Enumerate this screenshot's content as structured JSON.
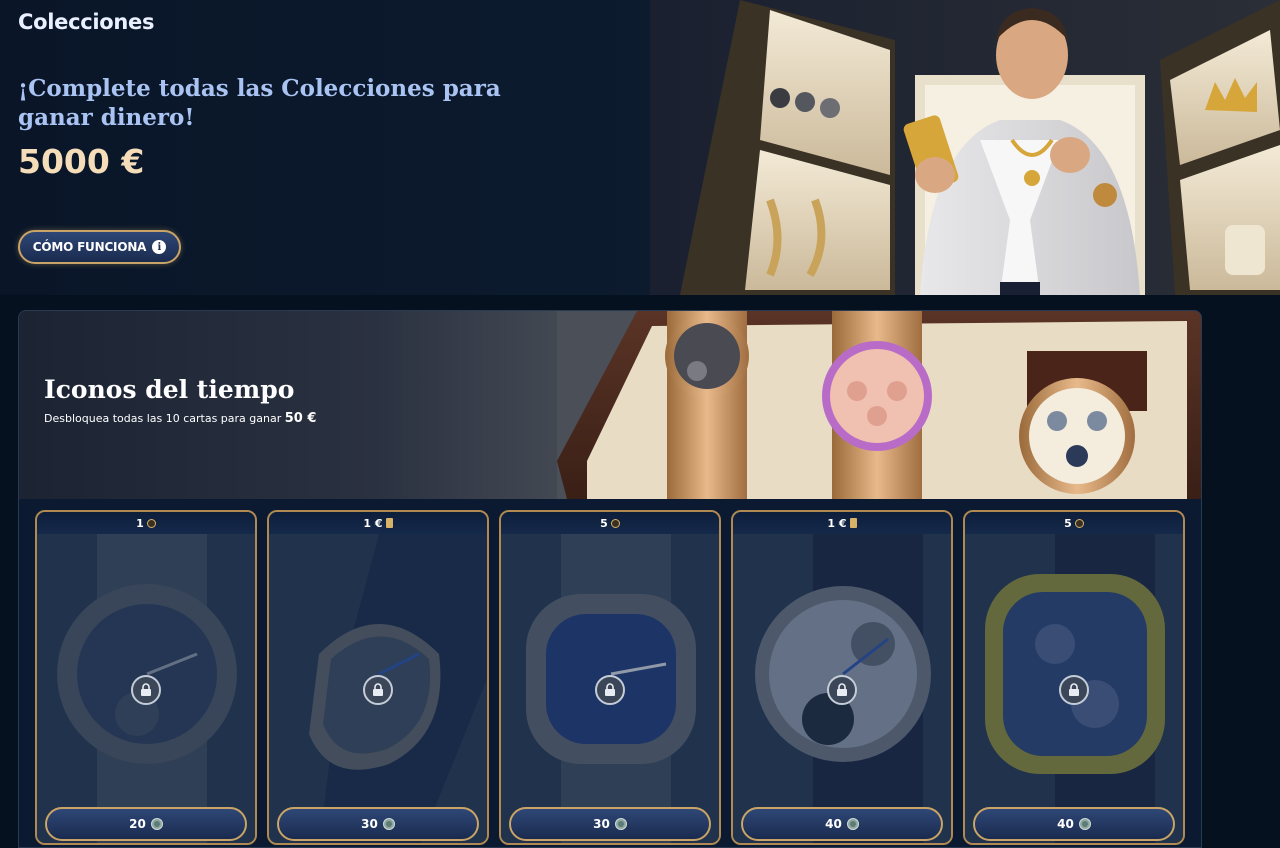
{
  "hero": {
    "title": "Colecciones",
    "subtitle": "¡Complete todas las Colecciones para ganar dinero!",
    "amount": "5000 €",
    "how_button": "CÓMO FUNCIONA"
  },
  "collection": {
    "title": "Iconos del tiempo",
    "description": "Desbloquea todas las 10 cartas para ganar",
    "reward": "50 €",
    "cards": [
      {
        "header_value": "1",
        "header_icon": "coin-icon",
        "price": "20",
        "price_icon": "gem-icon"
      },
      {
        "header_value": "1 €",
        "header_icon": "cash-icon",
        "price": "30",
        "price_icon": "gem-icon"
      },
      {
        "header_value": "5",
        "header_icon": "coin-icon",
        "price": "30",
        "price_icon": "gem-icon"
      },
      {
        "header_value": "1 €",
        "header_icon": "cash-icon",
        "price": "40",
        "price_icon": "gem-icon"
      },
      {
        "header_value": "5",
        "header_icon": "coin-icon",
        "price": "40",
        "price_icon": "gem-icon"
      }
    ]
  },
  "colors": {
    "background": "#061120",
    "gold_border": "#c9a466",
    "button_blue": "#2f4776",
    "amount_text": "#f4ddb8",
    "subtitle_text": "#a9c3f2"
  }
}
